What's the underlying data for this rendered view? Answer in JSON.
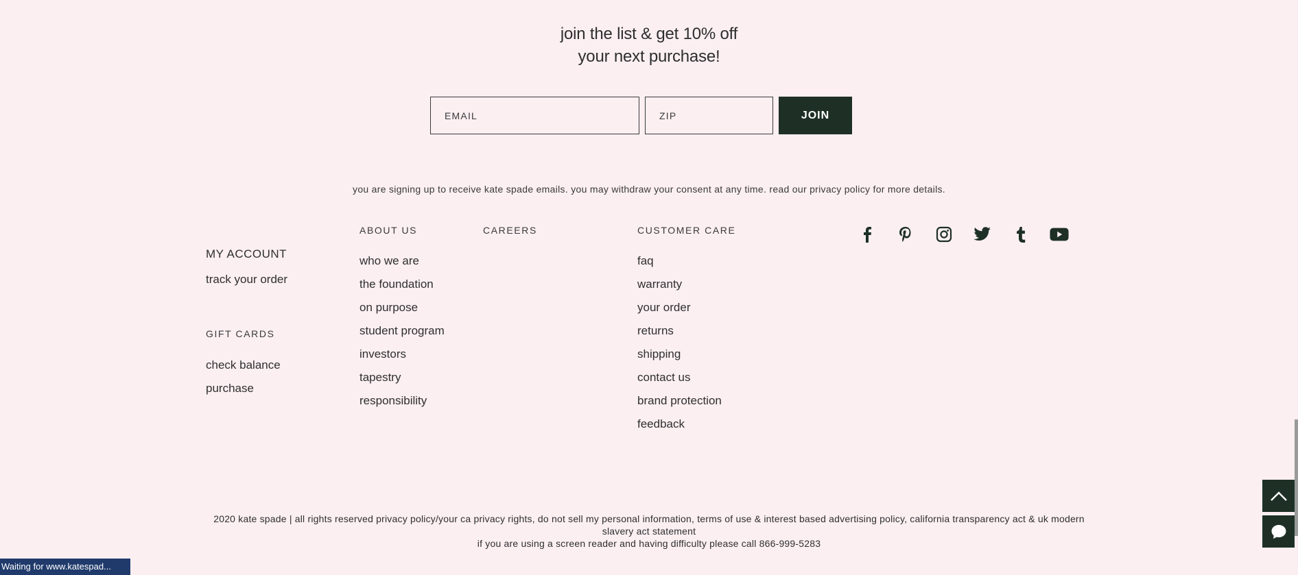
{
  "signup": {
    "headline_line1": "join the list & get 10% off",
    "headline_line2": "your next purchase!",
    "email_placeholder": "EMAIL",
    "zip_placeholder": "ZIP",
    "join_label": "JOIN",
    "consent_text": "you are signing up to receive kate spade emails. you may withdraw your consent at any time. read our privacy policy for more details."
  },
  "account": {
    "title": "MY ACCOUNT",
    "track_order": "track your order",
    "gift_cards_heading": "GIFT CARDS",
    "check_balance": "check balance",
    "purchase": "purchase"
  },
  "about": {
    "heading": "ABOUT US",
    "items": [
      "who we are",
      "the foundation",
      "on purpose",
      "student program",
      "investors",
      "tapestry",
      "responsibility"
    ]
  },
  "careers": {
    "heading": "CAREERS"
  },
  "customer_care": {
    "heading": "CUSTOMER CARE",
    "items": [
      "faq",
      "warranty",
      "your order",
      "returns",
      "shipping",
      "contact us",
      "brand protection",
      "feedback"
    ]
  },
  "social": [
    "facebook-icon",
    "pinterest-icon",
    "instagram-icon",
    "twitter-icon",
    "tumblr-icon",
    "youtube-icon"
  ],
  "legal": {
    "line1": "2020 kate spade | all rights reserved privacy policy/your ca privacy rights, do not sell my personal information, terms of use & interest based advertising policy, california transparency act & uk modern slavery act statement",
    "line2": "if you are using a screen reader and having difficulty please call 866-999-5283"
  },
  "status_bar": "Waiting for www.katespad...",
  "colors": {
    "background": "#fbeff2",
    "accent": "#1e3026",
    "status_bar": "#1f3a6b"
  }
}
